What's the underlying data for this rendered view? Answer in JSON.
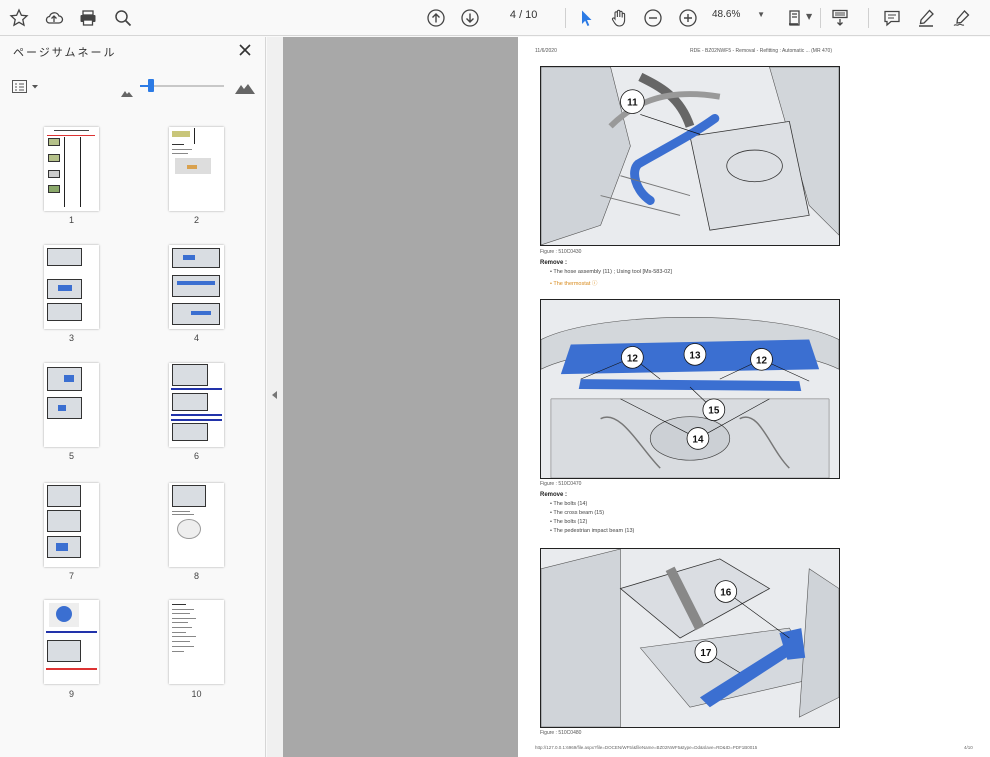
{
  "toolbar": {
    "page_current": "4",
    "page_total": "/ 10",
    "zoom": "48.6%"
  },
  "sidebar": {
    "title": "ページサムネール",
    "thumbnails": [
      "1",
      "2",
      "3",
      "4",
      "5",
      "6",
      "7",
      "8",
      "9",
      "10"
    ]
  },
  "document": {
    "header_left": "11/6/2020",
    "header_right": "RDE - BZ02NWF5 - Removal - Refitting : Automatic ... (MR 470)",
    "fig1_caption": "Figure : 510C0430",
    "fig1_callouts": [
      "11"
    ],
    "section1_heading": "Remove :",
    "section1_items": [
      "The hose assembly (11) ; Using tool [Ms-583-02]",
      "The thermostat"
    ],
    "fig2_caption": "Figure : 510C0470",
    "fig2_callouts": [
      "12",
      "13",
      "12",
      "15",
      "14"
    ],
    "section2_heading": "Remove :",
    "section2_items": [
      "The bolts (14)",
      "The cross beam (15)",
      "The bolts (12)",
      "The pedestrian impact beam (13)"
    ],
    "fig3_caption": "Figure : 510C0480",
    "fig3_callouts": [
      "16",
      "17"
    ],
    "footer_left": "http://127.0.0.1:6969/file.aspx?file=DOCEN/WF5/&fileName=BZ02NWF5&type=Dd&slave=RD&ID=PDF1B0015",
    "footer_right": "4/10"
  },
  "colors": {
    "accent": "#2c7be5",
    "part_blue": "#3b6fd1",
    "link_orange": "#d88a1c",
    "viewer_bg": "#a8a8a8"
  }
}
